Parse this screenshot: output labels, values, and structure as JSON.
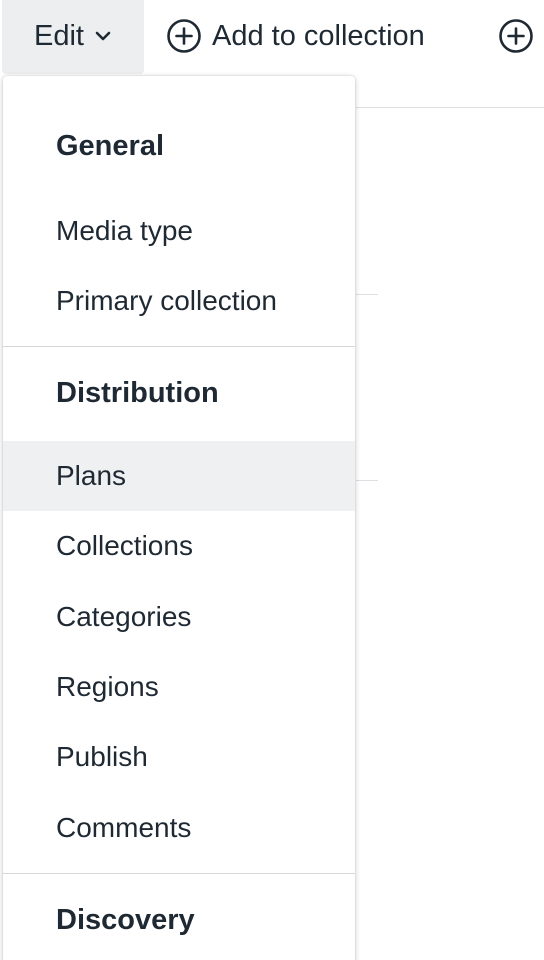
{
  "toolbar": {
    "edit_label": "Edit",
    "add_to_collection_label": "Add to collection"
  },
  "menu": {
    "sections": [
      {
        "heading": "General",
        "items": [
          "Media type",
          "Primary collection"
        ]
      },
      {
        "heading": "Distribution",
        "items": [
          "Plans",
          "Collections",
          "Categories",
          "Regions",
          "Publish",
          "Comments"
        ],
        "active_item": "Plans"
      },
      {
        "heading": "Discovery",
        "items": []
      }
    ]
  },
  "icons": {
    "edit_chevron": "chevron-down-icon",
    "add_collection": "plus-circle-icon",
    "add_more": "plus-circle-icon"
  },
  "colors": {
    "text": "#1f2933",
    "edit_button_bg": "#eceeef",
    "active_item_bg": "#eff0f1",
    "divider": "#d6d9dc"
  }
}
